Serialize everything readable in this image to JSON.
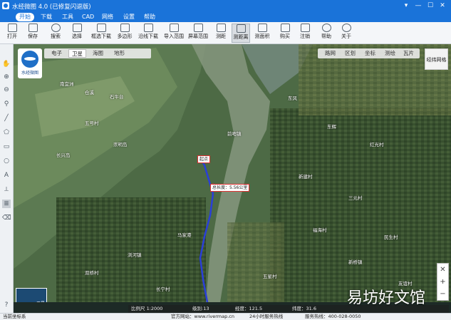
{
  "window": {
    "title": "水经微图 4.0 (已修复闪退版)",
    "controls": [
      "▾",
      "—",
      "☐",
      "✕"
    ]
  },
  "menu": {
    "items": [
      {
        "label": "开始",
        "active": true
      },
      {
        "label": "下载"
      },
      {
        "label": "工具"
      },
      {
        "label": "CAD"
      },
      {
        "label": "网络"
      },
      {
        "label": "设置"
      },
      {
        "label": "帮助"
      }
    ]
  },
  "toolbar": {
    "tools": [
      {
        "label": "打开"
      },
      {
        "label": "保存"
      },
      {
        "label": "搜索"
      },
      {
        "label": "选择"
      },
      {
        "label": "框选下载"
      },
      {
        "label": "多边形"
      },
      {
        "label": "沿线下载"
      },
      {
        "label": "导入范围"
      },
      {
        "label": "屏幕范围"
      },
      {
        "label": "测距"
      },
      {
        "label": "测距离",
        "pressed": true
      },
      {
        "label": "测面积"
      },
      {
        "label": "购买"
      },
      {
        "label": "注销"
      },
      {
        "label": "帮助"
      },
      {
        "label": "关于"
      }
    ]
  },
  "map": {
    "logo_text": "水经微图",
    "tabs": [
      {
        "label": "电子"
      },
      {
        "label": "卫星",
        "active": true
      },
      {
        "label": "海图"
      },
      {
        "label": "地形"
      }
    ],
    "ops": [
      "路网",
      "区划",
      "坐标",
      "测绘",
      "瓦片"
    ],
    "panel_button": "经纬网格",
    "zoom": [
      "✕",
      "+",
      "−"
    ],
    "thumbnail_label": "卫星",
    "measure_point_label": "起点",
    "measure_total_label": "总长度：5.56公里",
    "place_labels": [
      "南宜洲",
      "仓溪",
      "石牛台",
      "五号村",
      "长兴岛",
      "崇明岛",
      "前哨镇",
      "东风",
      "东辉",
      "红光村",
      "新建村",
      "三元村",
      "马家港",
      "浏河镇",
      "双桥村",
      "福海村",
      "民生村",
      "新桥镇",
      "五星村",
      "友谊村",
      "长宁村"
    ]
  },
  "coord_bar": {
    "scale": "比例尺 1:2000",
    "level": "级别:13",
    "lng": "经度：121.5",
    "lat": "纬度：31.6"
  },
  "status": {
    "left": "当前坐标系",
    "service": "服务热线：400-028-0050",
    "site": "官方网站：www.rivermap.cn",
    "hours": "24小时服务热线"
  },
  "watermark": "易坊好文馆",
  "colors": {
    "title_blue": "#1a73d9",
    "route": "#2a3fd8"
  }
}
